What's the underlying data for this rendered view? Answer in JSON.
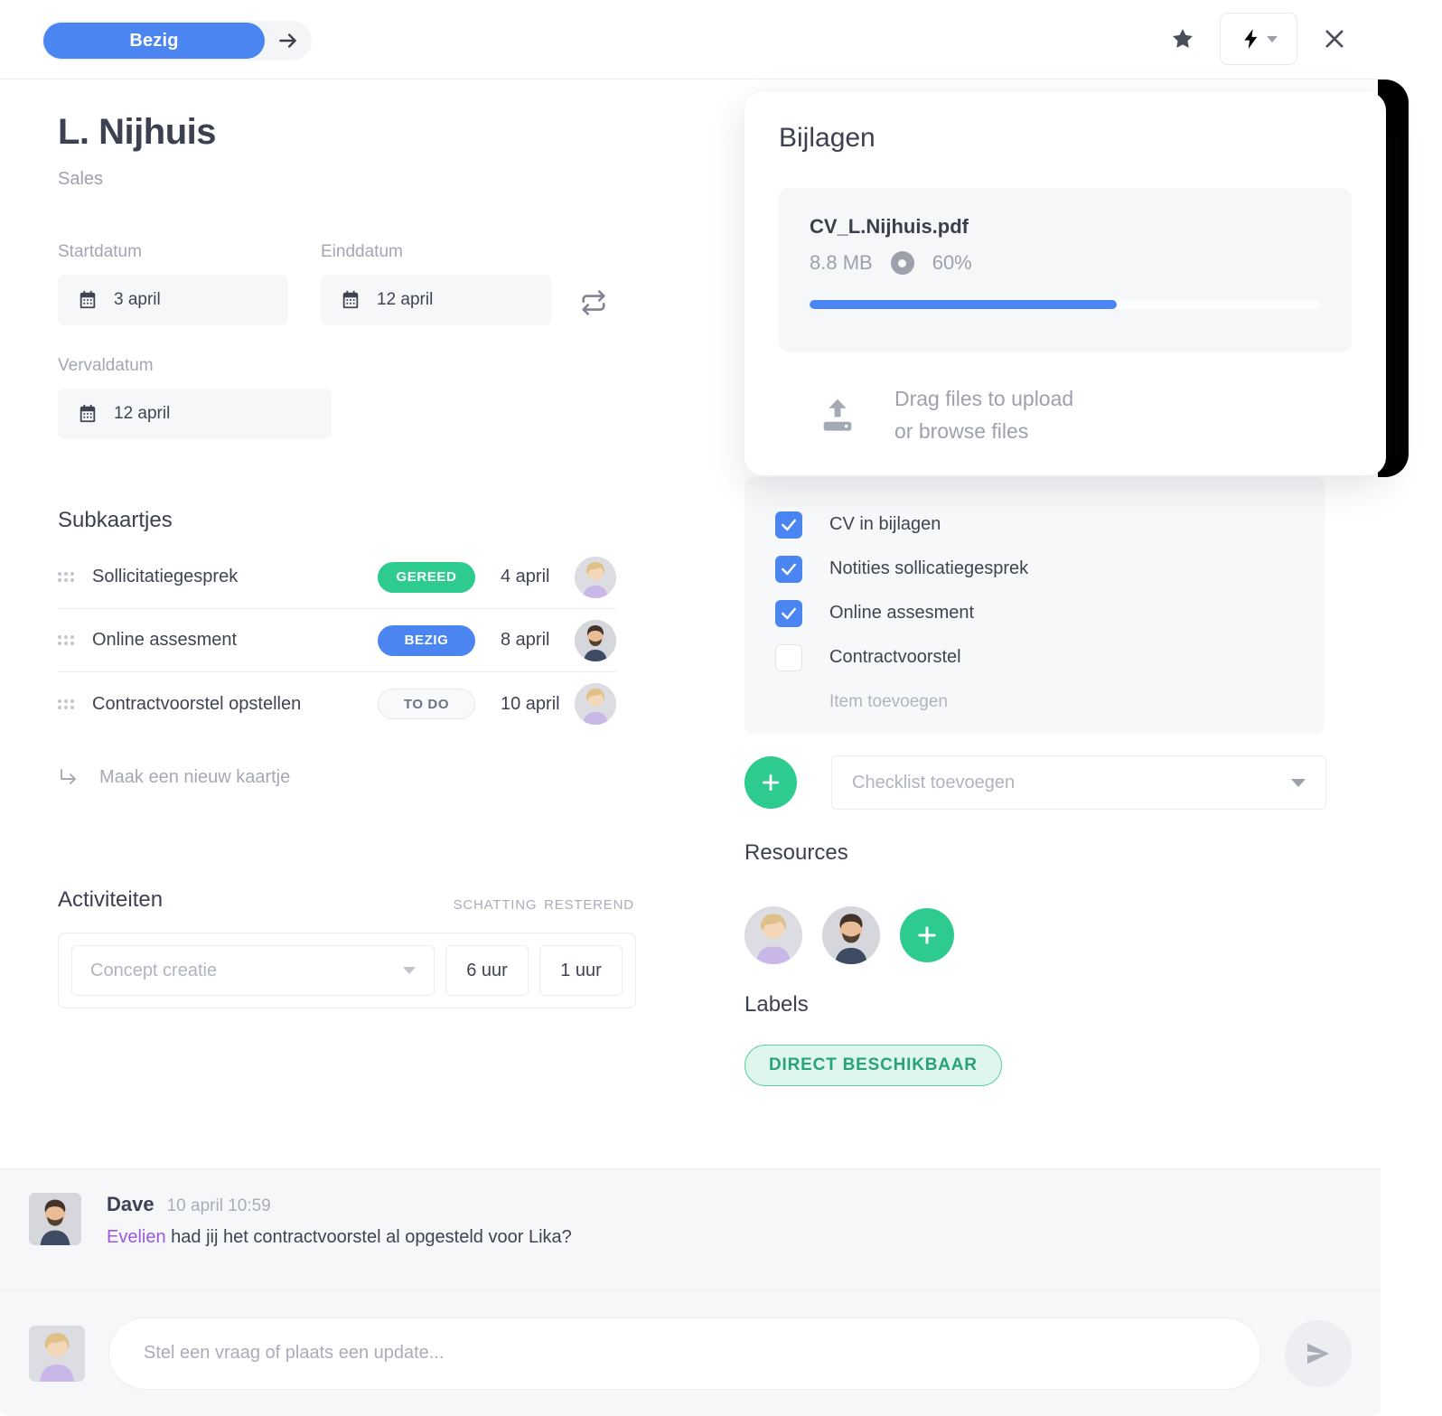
{
  "topbar": {
    "status_label": "Bezig",
    "next_arrow_icon": "arrow-right-icon",
    "star_icon": "star-icon",
    "lightning_icon": "lightning-bolt-icon",
    "close_icon": "close-icon"
  },
  "card": {
    "title": "L. Nijhuis",
    "subtitle": "Sales"
  },
  "dates": {
    "start_label": "Startdatum",
    "start_value": "3 april",
    "end_label": "Einddatum",
    "end_value": "12 april",
    "due_label": "Vervaldatum",
    "due_value": "12 april",
    "swap_icon": "sync-swap-icon"
  },
  "subcards": {
    "title": "Subkaartjes",
    "rows": [
      {
        "name": "Sollicitatiegesprek",
        "status": "GEREED",
        "status_kind": "done",
        "date": "4 april",
        "avatar": "woman-blonde"
      },
      {
        "name": "Online assesment",
        "status": "BEZIG",
        "status_kind": "busy",
        "date": "8 april",
        "avatar": "man-beard"
      },
      {
        "name": "Contractvoorstel opstellen",
        "status": "TO DO",
        "status_kind": "todo",
        "date": "10 april",
        "avatar": "woman-blonde"
      }
    ],
    "new_card_label": "Maak een nieuw kaartje"
  },
  "activities": {
    "title": "Activiteiten",
    "col_estimate": "SCHATTING",
    "col_remaining": "RESTEREND",
    "select_placeholder": "Concept creatie",
    "estimate_value": "6 uur",
    "remaining_value": "1 uur"
  },
  "attachments": {
    "title": "Bijlagen",
    "file_name": "CV_L.Nijhuis.pdf",
    "file_size": "8.8 MB",
    "progress_label": "60%",
    "progress_percent": 60,
    "progress_color": "#4a85f2",
    "dropzone_line1": "Drag files to upload",
    "dropzone_line2": "or browse files",
    "upload_icon": "upload-icon",
    "status_icon": "progress-donut-icon"
  },
  "checklist": {
    "items": [
      {
        "label": "CV in bijlagen",
        "checked": true
      },
      {
        "label": "Notities sollicatiegesprek",
        "checked": true
      },
      {
        "label": "Online assesment",
        "checked": true
      },
      {
        "label": "Contractvoorstel",
        "checked": false
      }
    ],
    "add_item_label": "Item toevoegen",
    "add_checklist_placeholder": "Checklist toevoegen",
    "add_button_icon": "plus-icon"
  },
  "resources": {
    "title": "Resources",
    "avatars": [
      "woman-blonde",
      "man-beard"
    ],
    "add_icon": "plus-icon"
  },
  "labels": {
    "title": "Labels",
    "chips": [
      {
        "text": "DIRECT BESCHIKBAAR",
        "color": "#2aa277",
        "background": "#dff6ec"
      }
    ]
  },
  "comments": [
    {
      "author": "Dave",
      "time": "10 april 10:59",
      "mention": "Evelien",
      "text": " had jij het contractvoorstel al opgesteld voor Lika?",
      "avatar": "man-beard"
    }
  ],
  "composer": {
    "placeholder": "Stel een vraag of plaats een update...",
    "send_icon": "send-icon",
    "avatar": "woman-blonde"
  }
}
